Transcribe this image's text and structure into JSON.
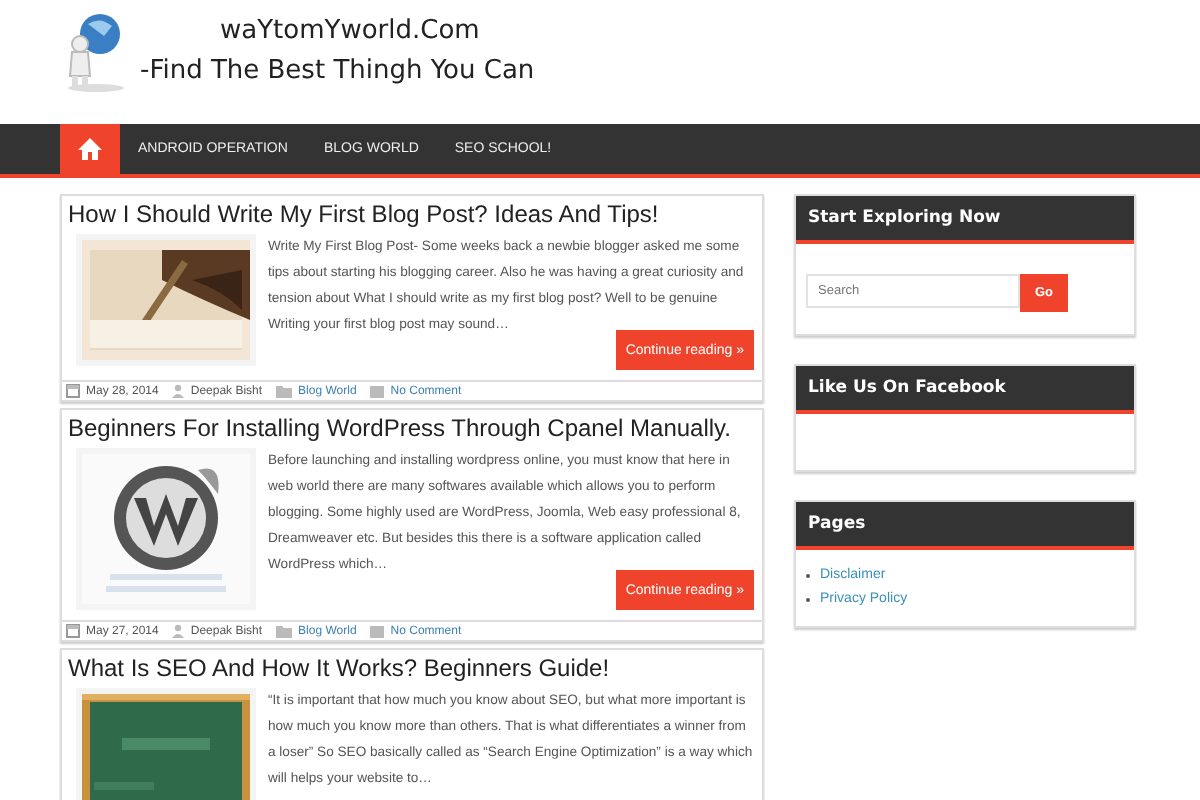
{
  "header": {
    "site_title": "waYtomYworld.Com",
    "tagline": "-Find The Best Thingh You Can"
  },
  "nav": {
    "items": [
      {
        "kind": "home",
        "selected": true
      },
      {
        "kind": "link",
        "label": "ANDROID OPERATION",
        "selected": false
      },
      {
        "kind": "link",
        "label": "BLOG WORLD",
        "selected": false
      },
      {
        "kind": "link",
        "label": "SEO SCHOOL!",
        "selected": false
      }
    ]
  },
  "posts": [
    {
      "title": "How I Should Write My First Blog Post? Ideas And Tips!",
      "excerpt": "Write My First Blog Post-  Some weeks back a newbie blogger asked me some tips about starting his blogging career. Also he was having a great curiosity and tension about What I should write as my first blog post? Well to be genuine Writing your first blog post may sound…",
      "button": "Continue reading »",
      "date": "May 28, 2014",
      "author": "Deepak Bisht",
      "category": "Blog World",
      "comments": "No Comment"
    },
    {
      "title": "Beginners For Installing WordPress Through Cpanel Manually.",
      "excerpt": "Before launching and installing wordpress online, you must know that here in web world there are many softwares available which allows you to perform blogging. Some highly used are WordPress, Joomla, Web easy professional 8, Dreamweaver etc. But besides this there is a software application called WordPress which…",
      "button": "Continue reading »",
      "date": "May 27, 2014",
      "author": "Deepak Bisht",
      "category": "Blog World",
      "comments": "No Comment"
    },
    {
      "title": "What Is SEO And How It Works? Beginners Guide!",
      "excerpt": "“It is important that how much you know about SEO, but what more important is how much you know more than others. That is what differentiates a winner from a loser” So SEO basically called as “Search Engine Optimization” is a way which will helps your website to…"
    }
  ],
  "sidebar": [
    {
      "kind": "search",
      "title": "Start Exploring Now",
      "placeholder": "Search",
      "button": "Go"
    },
    {
      "kind": "facebook",
      "title": "Like Us On Facebook"
    },
    {
      "kind": "links",
      "title": "Pages",
      "items": [
        "Disclaimer",
        "Privacy Policy"
      ]
    }
  ]
}
